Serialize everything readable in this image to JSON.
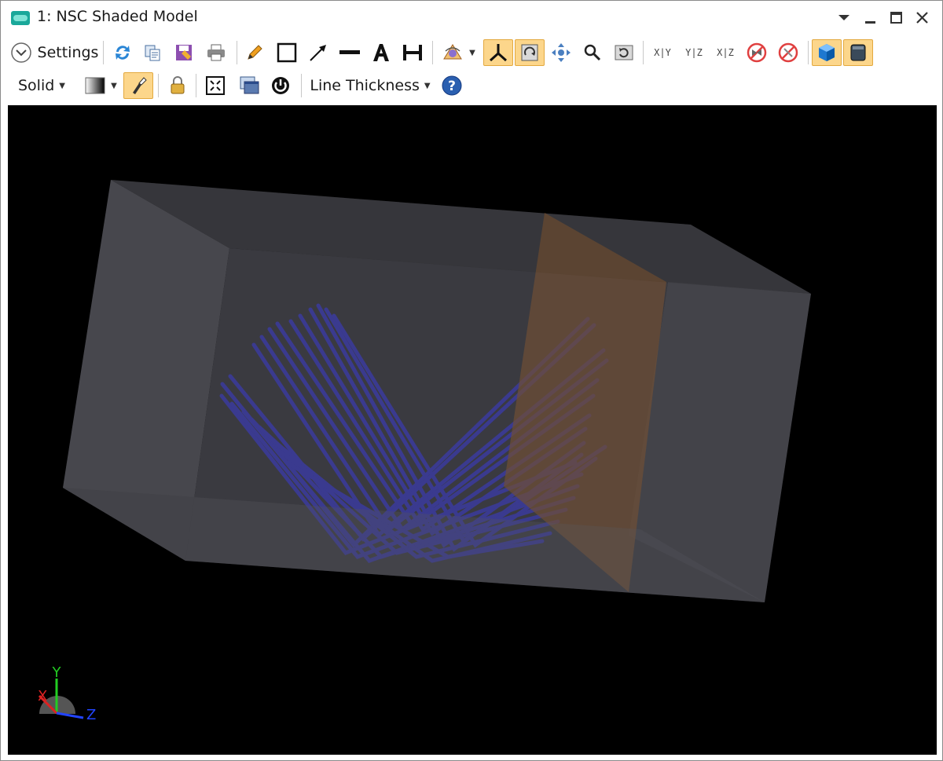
{
  "window": {
    "title": "1: NSC Shaded Model"
  },
  "toolbar": {
    "settings_label": "Settings",
    "render_mode_label": "Solid",
    "line_thickness_label": "Line Thickness",
    "axis_xy": "X|Y",
    "axis_yz": "Y|Z",
    "axis_xz": "X|Z"
  },
  "triad": {
    "x": "X",
    "y": "Y",
    "z": "Z"
  },
  "colors": {
    "accent_active": "#fcd68b",
    "viewport_bg": "#000000",
    "ray_color": "#2a2aa8",
    "detector_color": "#7a4a1e",
    "box_color": "#3a3a40"
  }
}
